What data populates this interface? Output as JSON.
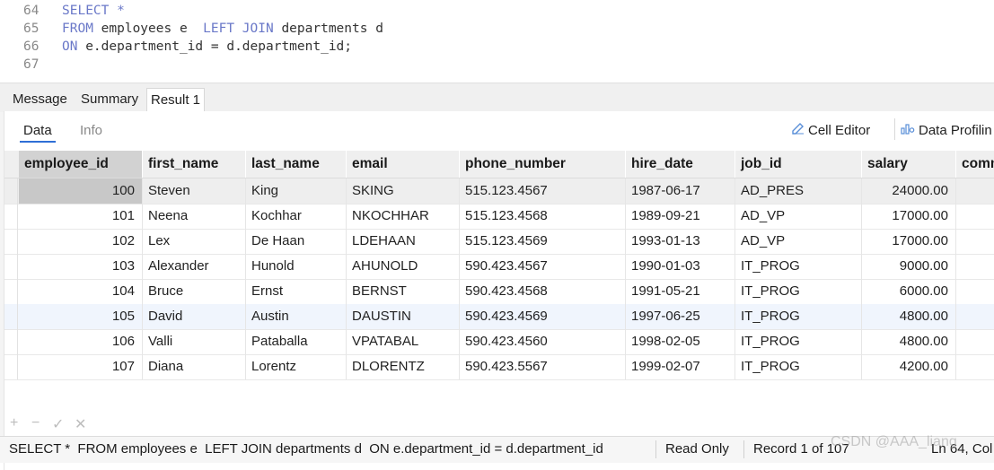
{
  "editor": {
    "lines": [
      {
        "num": "64",
        "parts": [
          {
            "kw": true,
            "t": "SELECT *"
          }
        ]
      },
      {
        "num": "65",
        "parts": [
          {
            "kw": true,
            "t": "FROM"
          },
          {
            "kw": false,
            "t": " employees e  "
          },
          {
            "kw": true,
            "t": "LEFT JOIN"
          },
          {
            "kw": false,
            "t": " departments d"
          }
        ]
      },
      {
        "num": "66",
        "parts": [
          {
            "kw": true,
            "t": "ON"
          },
          {
            "kw": false,
            "t": " e.department_id = d.department_id;"
          }
        ]
      },
      {
        "num": "67",
        "parts": []
      }
    ]
  },
  "result_tabs": [
    {
      "label": "Message",
      "active": false
    },
    {
      "label": "Summary",
      "active": false
    },
    {
      "label": "Result 1",
      "active": true
    }
  ],
  "sub_tabs": [
    {
      "label": "Data",
      "active": true
    },
    {
      "label": "Info",
      "active": false
    }
  ],
  "tools": {
    "cell_editor": "Cell Editor",
    "data_profiling": "Data Profilin"
  },
  "grid": {
    "columns": [
      "employee_id",
      "first_name",
      "last_name",
      "email",
      "phone_number",
      "hire_date",
      "job_id",
      "salary",
      "comm"
    ],
    "selected_row": 0,
    "hover_row": 5,
    "rows": [
      [
        "100",
        "Steven",
        "King",
        "SKING",
        "515.123.4567",
        "1987-06-17",
        "AD_PRES",
        "24000.00",
        ""
      ],
      [
        "101",
        "Neena",
        "Kochhar",
        "NKOCHHAR",
        "515.123.4568",
        "1989-09-21",
        "AD_VP",
        "17000.00",
        ""
      ],
      [
        "102",
        "Lex",
        "De Haan",
        "LDEHAAN",
        "515.123.4569",
        "1993-01-13",
        "AD_VP",
        "17000.00",
        ""
      ],
      [
        "103",
        "Alexander",
        "Hunold",
        "AHUNOLD",
        "590.423.4567",
        "1990-01-03",
        "IT_PROG",
        "9000.00",
        ""
      ],
      [
        "104",
        "Bruce",
        "Ernst",
        "BERNST",
        "590.423.4568",
        "1991-05-21",
        "IT_PROG",
        "6000.00",
        ""
      ],
      [
        "105",
        "David",
        "Austin",
        "DAUSTIN",
        "590.423.4569",
        "1997-06-25",
        "IT_PROG",
        "4800.00",
        ""
      ],
      [
        "106",
        "Valli",
        "Pataballa",
        "VPATABAL",
        "590.423.4560",
        "1998-02-05",
        "IT_PROG",
        "4800.00",
        ""
      ],
      [
        "107",
        "Diana",
        "Lorentz",
        "DLORENTZ",
        "590.423.5567",
        "1999-02-07",
        "IT_PROG",
        "4200.00",
        ""
      ]
    ]
  },
  "actions": {
    "add": "+",
    "remove": "−",
    "apply": "✓",
    "discard": "✕"
  },
  "status": {
    "query": "SELECT *  FROM employees e  LEFT JOIN departments d  ON e.department_id = d.department_id",
    "mode": "Read Only",
    "record": "Record 1 of 107",
    "position": "Ln 64, Col"
  },
  "watermark": "CSDN @AAA_liang"
}
